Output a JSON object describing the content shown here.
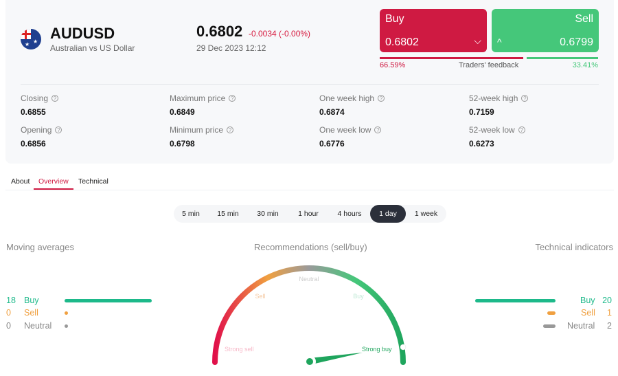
{
  "instrument": {
    "symbol": "AUDUSD",
    "name": "Australian vs US Dollar",
    "price": "0.6802",
    "change": "-0.0034 (-0.00%)",
    "datetime": "29 Dec 2023 12:12"
  },
  "trade": {
    "buy_label": "Buy",
    "buy_price": "0.6802",
    "sell_label": "Sell",
    "sell_price": "0.6799",
    "buy_pct": "66.59%",
    "sell_pct": "33.41%",
    "feedback_label": "Traders' feedback",
    "buy_fraction": 0.6659
  },
  "stats": [
    {
      "label": "Closing",
      "value": "0.6855"
    },
    {
      "label": "Maximum price",
      "value": "0.6849"
    },
    {
      "label": "One week high",
      "value": "0.6874"
    },
    {
      "label": "52-week high",
      "value": "0.7159"
    },
    {
      "label": "Opening",
      "value": "0.6856"
    },
    {
      "label": "Minimum price",
      "value": "0.6798"
    },
    {
      "label": "One week low",
      "value": "0.6776"
    },
    {
      "label": "52-week low",
      "value": "0.6273"
    }
  ],
  "tabs": [
    {
      "label": "About"
    },
    {
      "label": "Overview"
    },
    {
      "label": "Technical"
    }
  ],
  "active_tab": "Overview",
  "timeframes": [
    "5 min",
    "15 min",
    "30 min",
    "1 hour",
    "4 hours",
    "1 day",
    "1 week"
  ],
  "active_timeframe": "1 day",
  "moving_averages": {
    "title": "Moving averages",
    "buy": {
      "count": "18",
      "label": "Buy"
    },
    "sell": {
      "count": "0",
      "label": "Sell"
    },
    "neutral": {
      "count": "0",
      "label": "Neutral"
    }
  },
  "technical_indicators": {
    "title": "Technical indicators",
    "buy": {
      "count": "20",
      "label": "Buy"
    },
    "sell": {
      "count": "1",
      "label": "Sell"
    },
    "neutral": {
      "count": "2",
      "label": "Neutral"
    }
  },
  "gauge": {
    "title": "Recommendations (sell/buy)",
    "labels": {
      "strong_sell": "Strong sell",
      "sell": "Sell",
      "neutral": "Neutral",
      "buy": "Buy",
      "strong_buy": "Strong buy"
    },
    "reading": "Strong buy"
  },
  "colors": {
    "buy": "#cf1a42",
    "sell": "#45c77a",
    "ma_buy": "#1db98a",
    "orange": "#f0a040",
    "neutral": "#999999"
  }
}
